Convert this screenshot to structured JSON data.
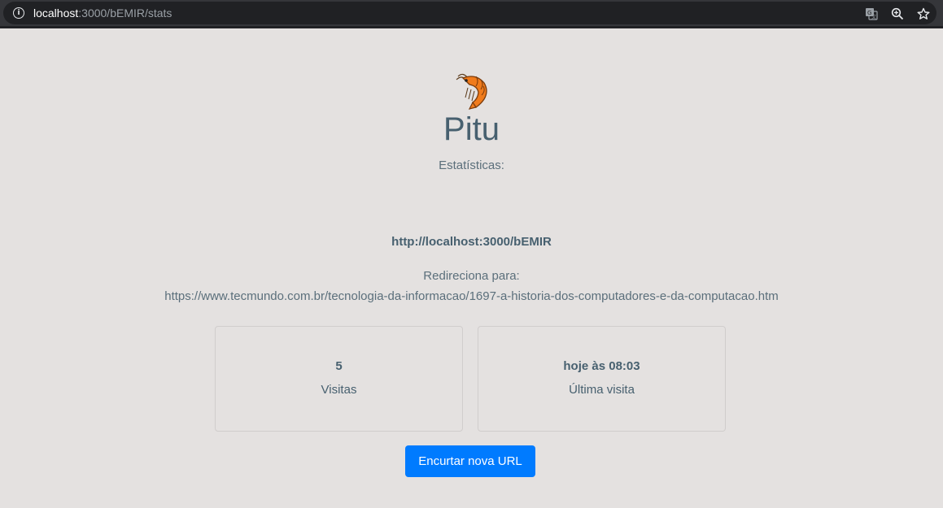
{
  "browser": {
    "url_host": "localhost",
    "url_path": ":3000/bEMIR/stats",
    "icons": [
      "info-icon",
      "translate-icon",
      "zoom-icon",
      "bookmark-star-icon"
    ]
  },
  "page": {
    "logo_icon": "shrimp-icon",
    "brand": "Pitu",
    "subtitle": "Estatísticas:",
    "short_url": "http://localhost:3000/bEMIR",
    "redirect_label": "Redireciona para:",
    "target_url": "https://www.tecmundo.com.br/tecnologia-da-informacao/1697-a-historia-dos-computadores-e-da-computacao.htm"
  },
  "stats": {
    "visits_value": "5",
    "visits_label": "Visitas",
    "last_visit_value": "hoje às 08:03",
    "last_visit_label": "Última visita"
  },
  "actions": {
    "shorten_new": "Encurtar nova URL"
  },
  "colors": {
    "background": "#e4e1e0",
    "text": "#47606f",
    "button": "#007bff"
  }
}
